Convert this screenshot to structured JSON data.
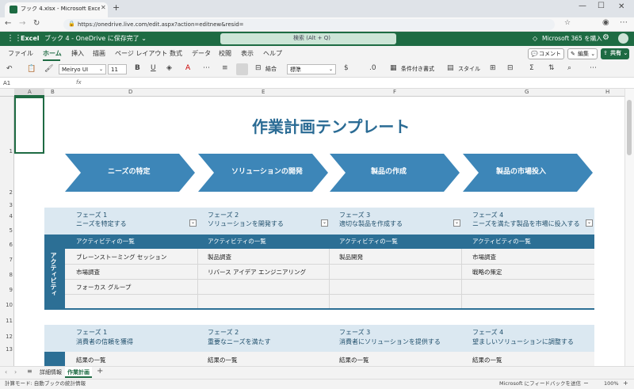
{
  "browser": {
    "tab_title": "ブック 4.xlsx - Microsoft Excel Onli",
    "url": "https://onedrive.live.com/edit.aspx?action=editnew&resid="
  },
  "appbar": {
    "app_name": "Excel",
    "doc_title": "ブック 4 - OneDrive に保存完了 ⌄",
    "search_placeholder": "検索 (Alt + Q)",
    "m365_label": "Microsoft 365 を購入"
  },
  "menu": {
    "items": [
      "ファイル",
      "ホーム",
      "挿入",
      "描画",
      "ページ レイアウト",
      "数式",
      "データ",
      "校閲",
      "表示",
      "ヘルプ"
    ],
    "active": "ホーム",
    "comment_button": "コメント",
    "edit_button": "編集 ⌄",
    "share_button": "共有 ⌄"
  },
  "toolbar": {
    "font_name": "Meiryo UI",
    "font_size": "11",
    "merge_label": "結合",
    "number_format": "標準",
    "conditional_label": "条件付き書式",
    "style_label": "スタイル"
  },
  "formula": {
    "name_box": "A1",
    "fx": "fx"
  },
  "columns": [
    "A",
    "B",
    "D",
    "E",
    "F",
    "G",
    "H"
  ],
  "rows": [
    "1",
    "2",
    "3",
    "4",
    "5",
    "6",
    "7",
    "8",
    "9",
    "10",
    "11",
    "12",
    "13"
  ],
  "sheet": {
    "title": "作業計画テンプレート",
    "arrows": [
      "ニーズの特定",
      "ソリューションの開発",
      "製品の作成",
      "製品の市場投入"
    ],
    "table1": {
      "phases": [
        {
          "num": "フェーズ 1",
          "name": "ニーズを特定する"
        },
        {
          "num": "フェーズ 2",
          "name": "ソリューションを開発する"
        },
        {
          "num": "フェーズ 3",
          "name": "適切な製品を作成する"
        },
        {
          "num": "フェーズ 4",
          "name": "ニーズを満たす製品を市場に投入する"
        }
      ],
      "side_label": "アクティビティ",
      "list_header": "アクティビティの一覧",
      "cells": [
        [
          "ブレーンストーミング セッション",
          "製品調査",
          "製品開発",
          "市場調査"
        ],
        [
          "市場調査",
          "リバース アイデア エンジニアリング",
          "",
          "戦略の策定"
        ],
        [
          "フォーカス グループ",
          "",
          "",
          ""
        ]
      ]
    },
    "table2": {
      "phases": [
        {
          "num": "フェーズ 1",
          "name": "消費者の信頼を獲得"
        },
        {
          "num": "フェーズ 2",
          "name": "重要なニーズを満たす"
        },
        {
          "num": "フェーズ 3",
          "name": "消費者にソリューションを提供する"
        },
        {
          "num": "フェーズ 4",
          "name": "望ましいソリューションに調整する"
        }
      ],
      "list_header": "結果の一覧"
    }
  },
  "sheet_tabs": [
    "詳細情報",
    "作業計画"
  ],
  "active_sheet": "作業計画",
  "status": {
    "calc_mode": "計算モード: 自動",
    "workbook_stats": "ブックの統計情報",
    "feedback": "Microsoft にフィードバックを送信",
    "zoom": "100%"
  },
  "colors": {
    "excel_green": "#1e6b43",
    "arrow_blue": "#3d86b8",
    "header_band": "#dbe8f1",
    "dark_row": "#2c6f95",
    "title_color": "#2a6b94"
  }
}
